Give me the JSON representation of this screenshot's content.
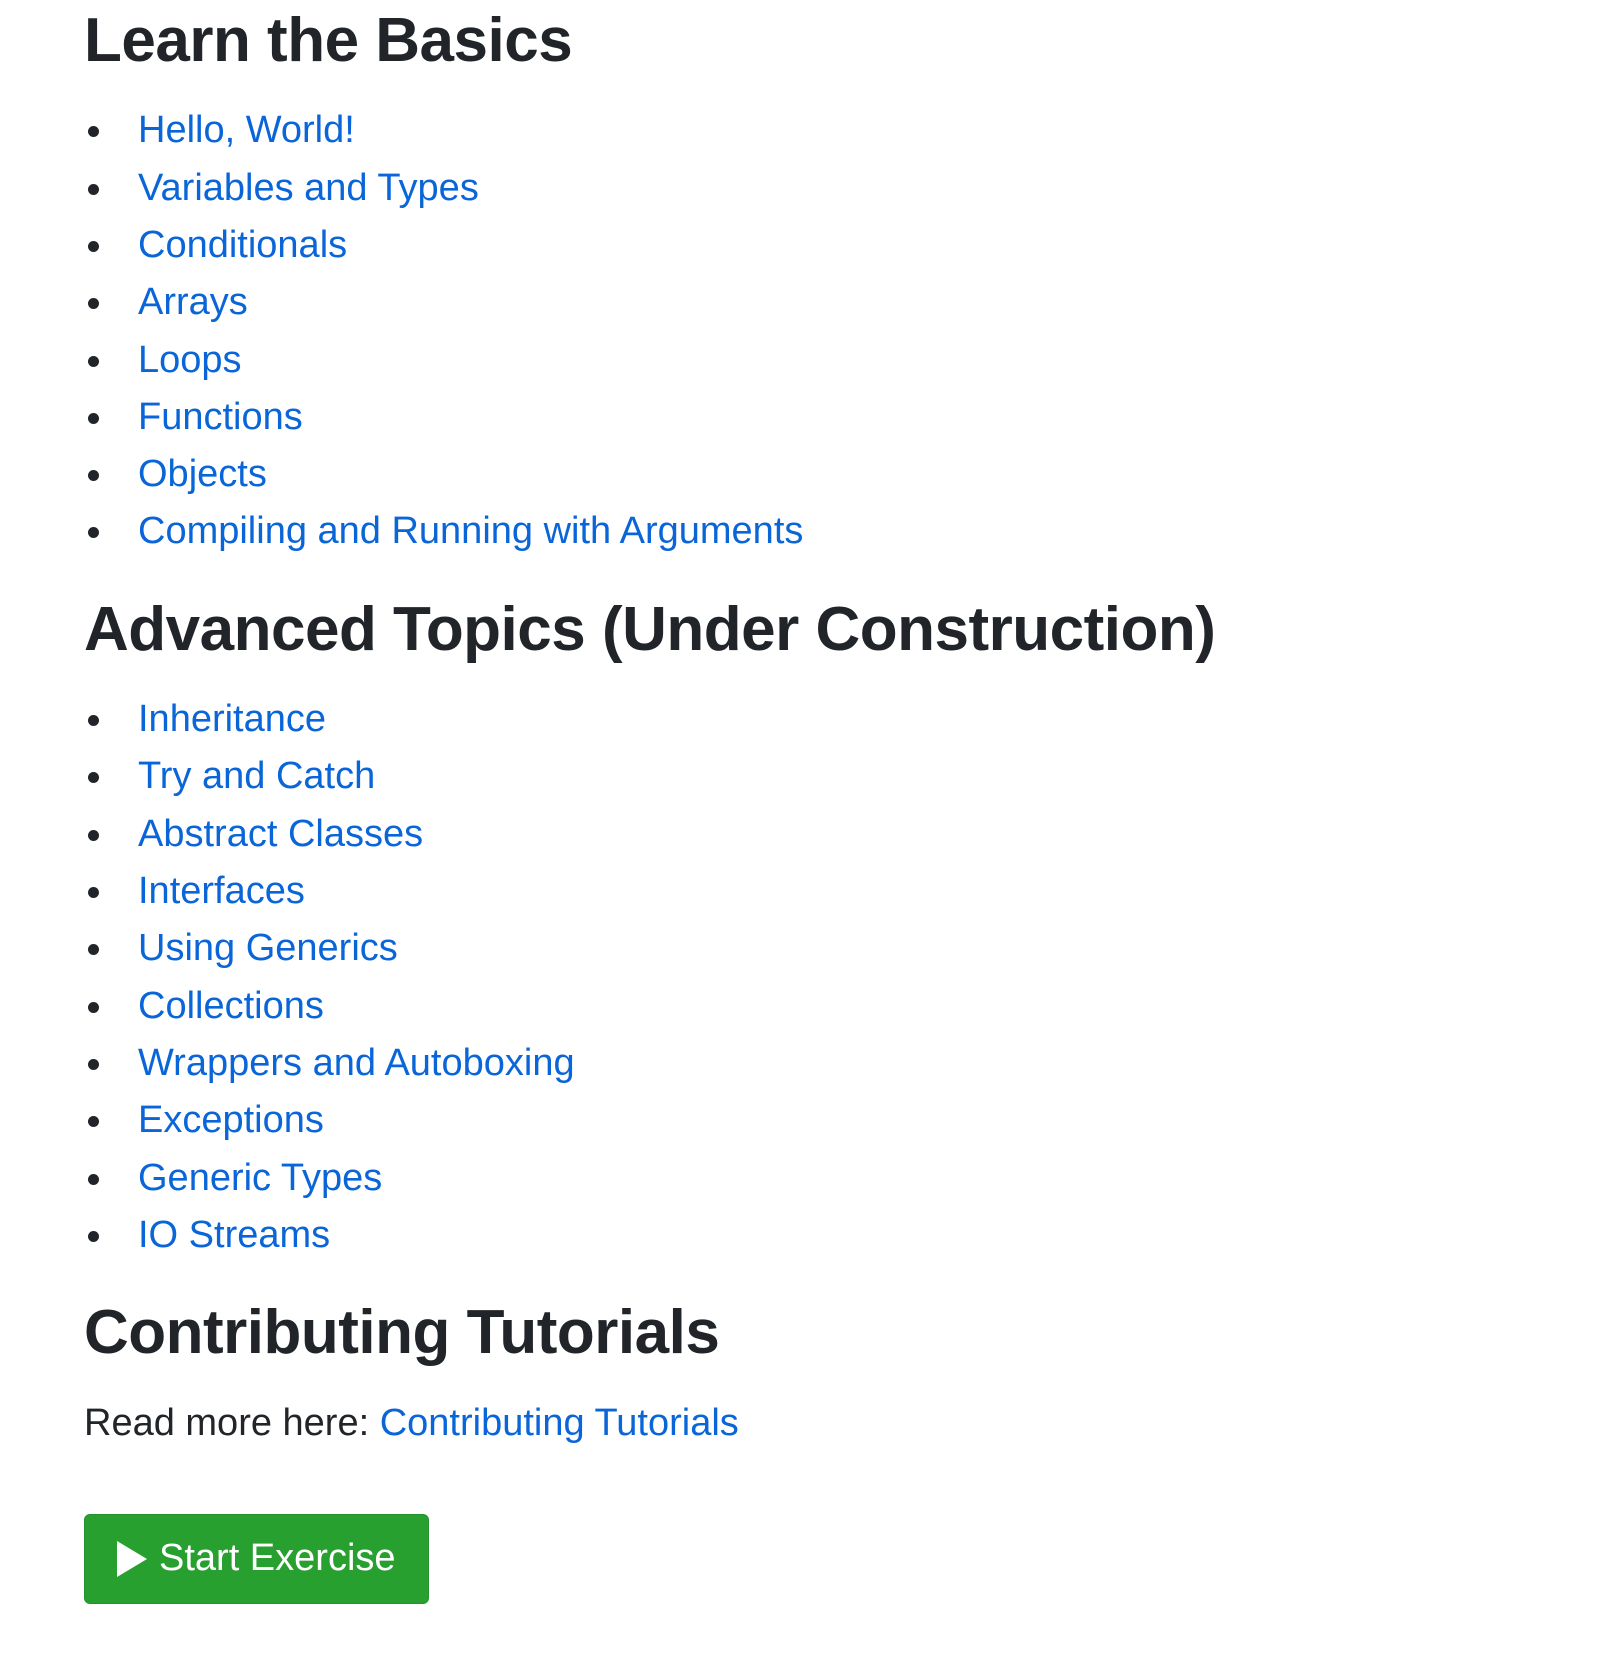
{
  "sections": {
    "basics": {
      "title": "Learn the Basics",
      "items": [
        "Hello, World!",
        "Variables and Types",
        "Conditionals",
        "Arrays",
        "Loops",
        "Functions",
        "Objects",
        "Compiling and Running with Arguments"
      ]
    },
    "advanced": {
      "title": "Advanced Topics (Under Construction)",
      "items": [
        "Inheritance",
        "Try and Catch",
        "Abstract Classes",
        "Interfaces",
        "Using Generics",
        "Collections",
        "Wrappers and Autoboxing",
        "Exceptions",
        "Generic Types",
        "IO Streams"
      ]
    },
    "contributing": {
      "title": "Contributing Tutorials",
      "read_more_prefix": "Read more here: ",
      "link_label": "Contributing Tutorials"
    }
  },
  "start_button": {
    "label": "Start Exercise",
    "icon": "play-icon"
  },
  "colors": {
    "link": "#0a66d8",
    "text": "#212529",
    "button_bg": "#28a030"
  }
}
